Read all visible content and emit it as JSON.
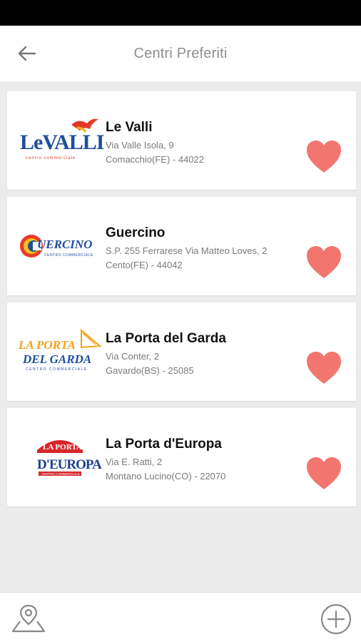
{
  "header": {
    "title": "Centri Preferiti",
    "back_icon": "arrow-left-icon"
  },
  "colors": {
    "heart": "#f2766f",
    "title": "#8f8f8f",
    "address": "#7a7a7a"
  },
  "centers": [
    {
      "name": "Le Valli",
      "address_line1": "Via Valle Isola, 9",
      "address_line2": "Comacchio(FE) - 44022",
      "logo_text": "LE VALLI",
      "logo_subtext": "centro commerciale"
    },
    {
      "name": "Guercino",
      "address_line1": "S.P. 255 Ferrarese Via Matteo Loves, 2",
      "address_line2": "Cento(FE) - 44042",
      "logo_text": "GUERCINO",
      "logo_subtext": "CENTRO COMMERCIALE"
    },
    {
      "name": "La Porta del Garda",
      "address_line1": "Via Conter, 2",
      "address_line2": "Gavardo(BS) - 25085",
      "logo_text": "LA PORTA DEL GARDA",
      "logo_subtext": "CENTRO COMMERCIALE"
    },
    {
      "name": "La Porta d'Europa",
      "address_line1": "Via E. Ratti, 2",
      "address_line2": "Montano Lucino(CO) - 22070",
      "logo_text": "LA PORTA D'EUROPA",
      "logo_subtext": "CENTRO COMMERCIALE"
    }
  ],
  "bottom_bar": {
    "map_icon": "map-pin-icon",
    "add_icon": "add-circle-icon"
  }
}
